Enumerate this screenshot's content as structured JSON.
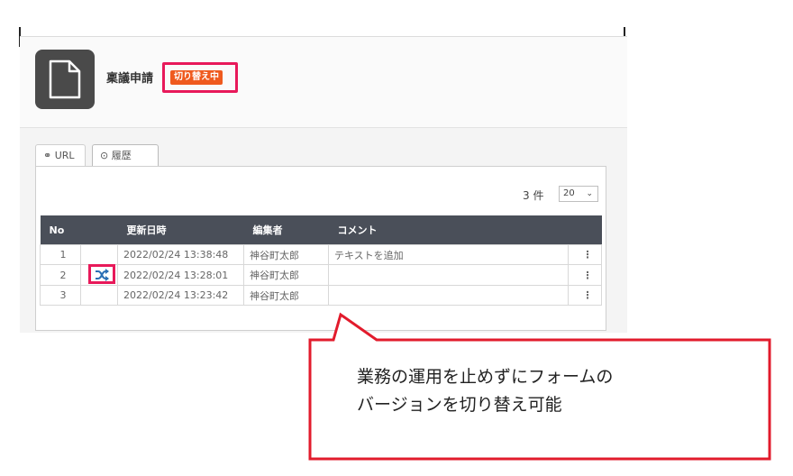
{
  "form": {
    "title": "稟議申請",
    "badge": "切り替え中"
  },
  "tabs": [
    {
      "icon": "link-icon",
      "label": "URL"
    },
    {
      "icon": "clock-icon",
      "label": "履歴"
    }
  ],
  "pagination": {
    "count": "3 件",
    "per_page": "20"
  },
  "table": {
    "headers": [
      "No",
      "",
      "更新日時",
      "編集者",
      "コメント",
      ""
    ],
    "rows": [
      {
        "no": "1",
        "date": "2022/02/24 13:38:48",
        "editor": "神谷町太郎",
        "comment": "テキストを追加",
        "current": false
      },
      {
        "no": "2",
        "date": "2022/02/24 13:28:01",
        "editor": "神谷町太郎",
        "comment": "",
        "current": true
      },
      {
        "no": "3",
        "date": "2022/02/24 13:23:42",
        "editor": "神谷町太郎",
        "comment": "",
        "current": false
      }
    ]
  },
  "callout": {
    "line1": "業務の運用を止めずにフォームの",
    "line2": "バージョンを切り替え可能"
  },
  "colors": {
    "highlight": "#e8195a",
    "badge": "#ef5a1e",
    "table_header": "#4a4f59",
    "shuffle": "#2b6fb5"
  }
}
